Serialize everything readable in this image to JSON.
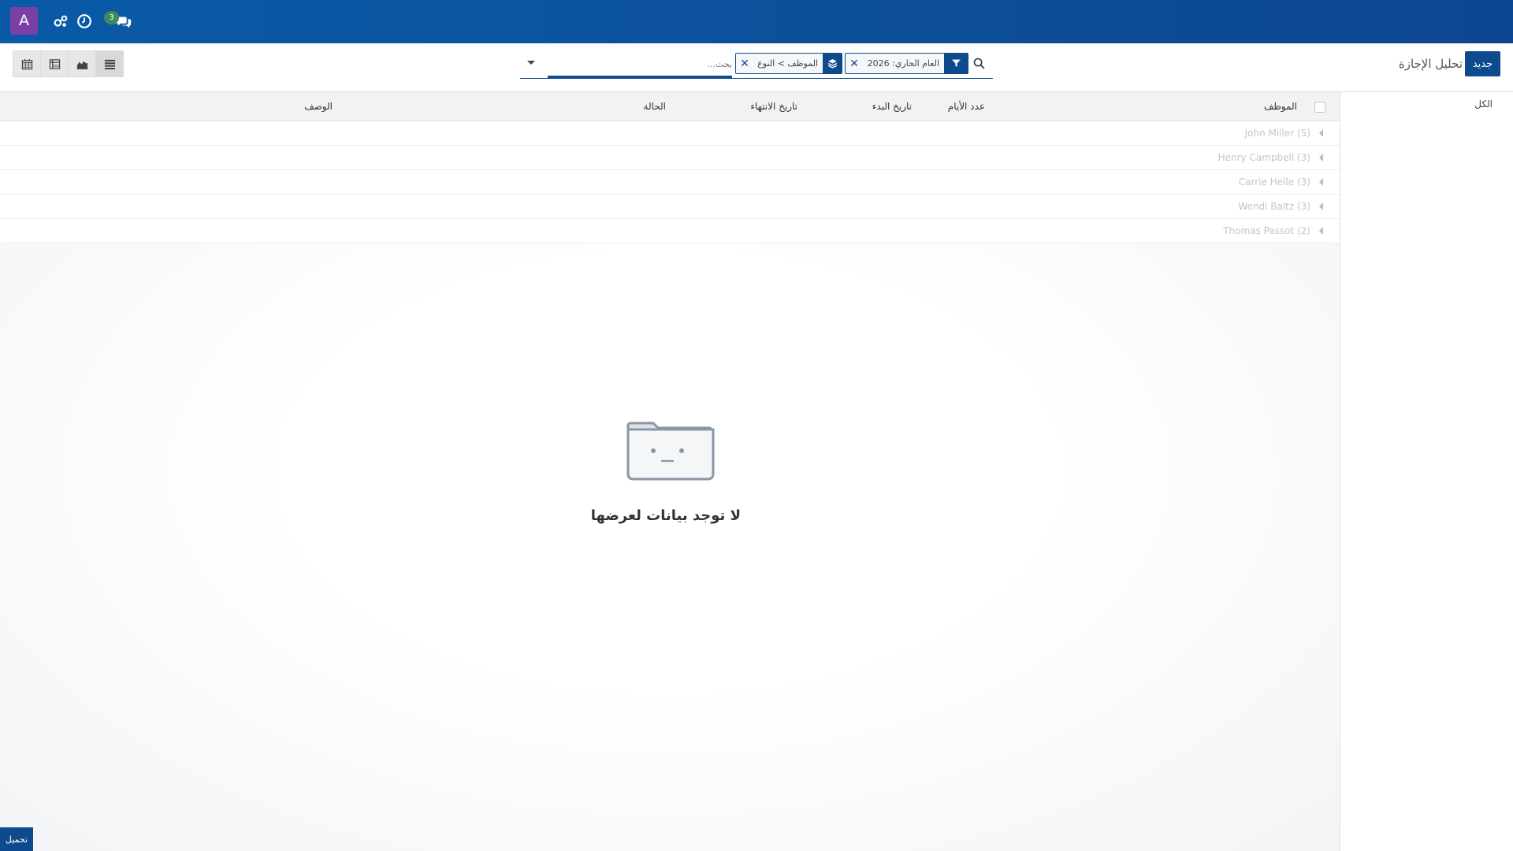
{
  "navbar": {
    "avatar_letter": "A",
    "messages_count": "3"
  },
  "control_panel": {
    "new_button": "جديد",
    "breadcrumb": "تحليل الإجازة",
    "search": {
      "placeholder": "بحث...",
      "filter_facet": "العام الحاري: 2026",
      "group_facet": "الموظف > النوع"
    }
  },
  "search_panel": {
    "all_label": "الكل"
  },
  "list": {
    "columns": [
      "الموظف",
      "عدد الأيام",
      "تاريخ البدء",
      "تاريخ الانتهاء",
      "الحالة",
      "الوصف"
    ],
    "groups": [
      {
        "label": "John Miller (5)"
      },
      {
        "label": "Henry Campbell (3)"
      },
      {
        "label": "Carrie Helle (3)"
      },
      {
        "label": "Wendi Baltz (3)"
      },
      {
        "label": "Thomas Passot (2)"
      }
    ]
  },
  "empty_state": {
    "text": "لا توجد بيانات لعرضها"
  },
  "load_button": "تحميل",
  "colors": {
    "brand": "#0d4a8e",
    "avatar": "#7b3fa8",
    "badge": "#3d8a5c"
  }
}
